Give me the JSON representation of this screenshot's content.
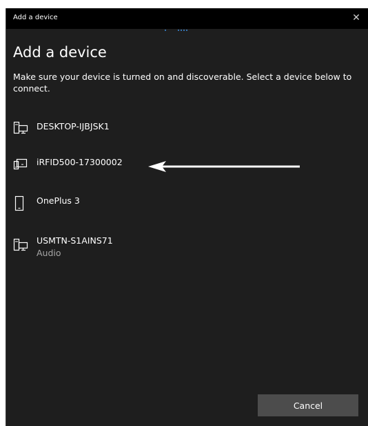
{
  "window": {
    "title": "Add a device",
    "close_glyph": "✕"
  },
  "heading": "Add a device",
  "description": "Make sure your device is turned on and discoverable. Select a device below to connect.",
  "devices": [
    {
      "name": "DESKTOP-IJBJSK1",
      "subtitle": "",
      "icon": "desktop-icon"
    },
    {
      "name": "iRFID500-17300002",
      "subtitle": "",
      "icon": "input-device-icon"
    },
    {
      "name": "OnePlus 3",
      "subtitle": "",
      "icon": "phone-icon"
    },
    {
      "name": "USMTN-S1AINS71",
      "subtitle": "Audio",
      "icon": "desktop-icon"
    }
  ],
  "cancel_label": "Cancel",
  "colors": {
    "background": "#1e1e1e",
    "titlebar": "#000000",
    "button": "#4c4c4c",
    "accent_dots": "#3b8ee0",
    "secondary_text": "#a6a6a6"
  }
}
